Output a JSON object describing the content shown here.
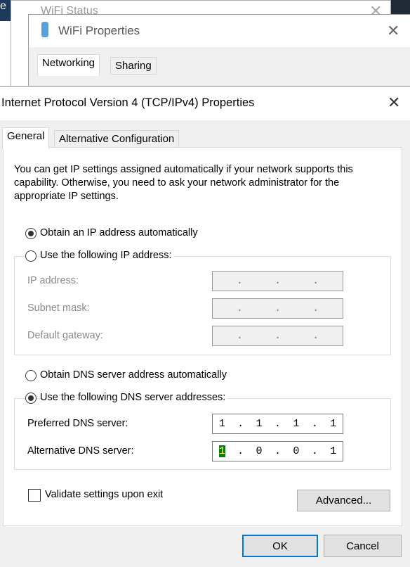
{
  "background": {
    "left_text": "e",
    "wifi_status_title": "WiFi Status"
  },
  "wifi_properties": {
    "title": "WiFi Properties",
    "tabs": [
      "Networking",
      "Sharing"
    ]
  },
  "dialog": {
    "title": "Internet Protocol Version 4 (TCP/IPv4) Properties",
    "tabs": [
      "General",
      "Alternative Configuration"
    ],
    "description": "You can get IP settings assigned automatically if your network supports this capability. Otherwise, you need to ask your network administrator for the appropriate IP settings.",
    "ip_auto_label": "Obtain an IP address automatically",
    "ip_manual_label": "Use the following IP address:",
    "ip_mode": "automatic",
    "ip_fields": [
      {
        "label": "IP address:",
        "value": [
          "",
          "",
          "",
          ""
        ]
      },
      {
        "label": "Subnet mask:",
        "value": [
          "",
          "",
          "",
          ""
        ]
      },
      {
        "label": "Default gateway:",
        "value": [
          "",
          "",
          "",
          ""
        ]
      }
    ],
    "dns_auto_label": "Obtain DNS server address automatically",
    "dns_manual_label": "Use the following DNS server addresses:",
    "dns_mode": "manual",
    "dns_fields": [
      {
        "label": "Preferred DNS server:",
        "value": [
          "1",
          "1",
          "1",
          "1"
        ]
      },
      {
        "label": "Alternative DNS server:",
        "value": [
          "1",
          "0",
          "0",
          "1"
        ]
      }
    ],
    "validate_label": "Validate settings upon exit",
    "validate_checked": false,
    "advanced_label": "Advanced...",
    "ok_label": "OK",
    "cancel_label": "Cancel"
  },
  "colors": {
    "highlight": "#ffff30",
    "ok_border": "#0078d7"
  }
}
